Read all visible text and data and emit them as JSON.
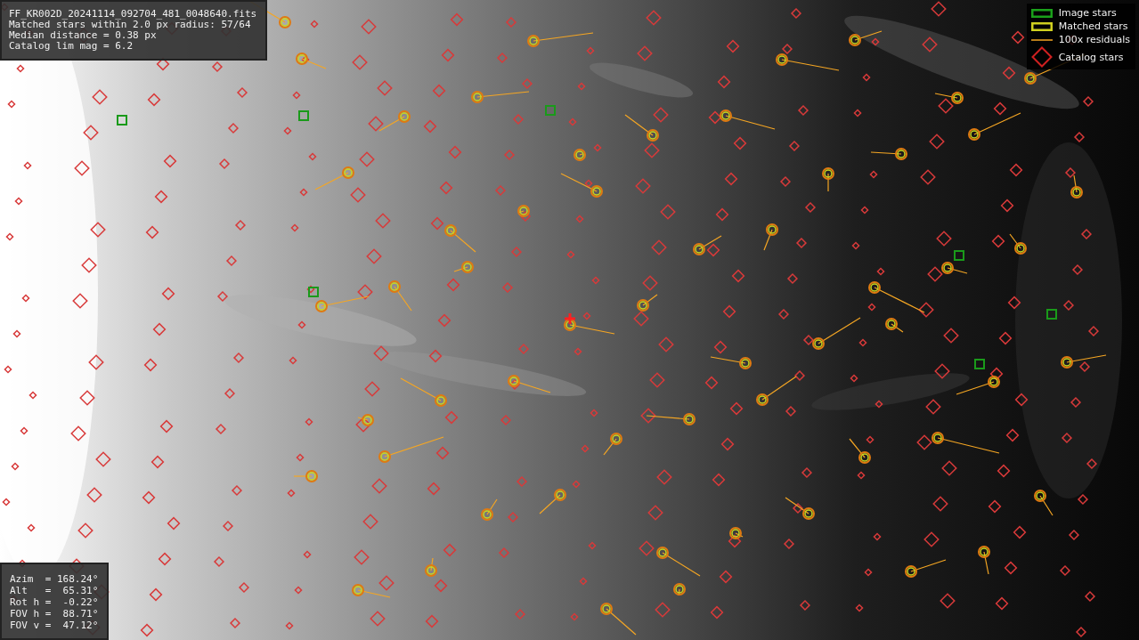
{
  "info_box": {
    "lines": [
      "FF_KR002D_20241114_092704_481_0048640.fits",
      "Matched stars within 2.0 px radius: 57/64",
      "Median distance = 0.38 px",
      "Catalog lim mag = 6.2"
    ]
  },
  "legend": [
    {
      "kind": "image_stars",
      "label": "Image stars"
    },
    {
      "kind": "matched_stars",
      "label": "Matched stars"
    },
    {
      "kind": "residuals",
      "label": "100x residuals"
    },
    {
      "kind": "catalog_stars",
      "label": "Catalog stars"
    }
  ],
  "pointing_box": {
    "lines": [
      "Azim  = 168.24°",
      "Alt   =  65.31°",
      "Rot h =  -0.22°",
      "FOV h =  88.71°",
      "FOV v =  47.12°"
    ]
  }
}
